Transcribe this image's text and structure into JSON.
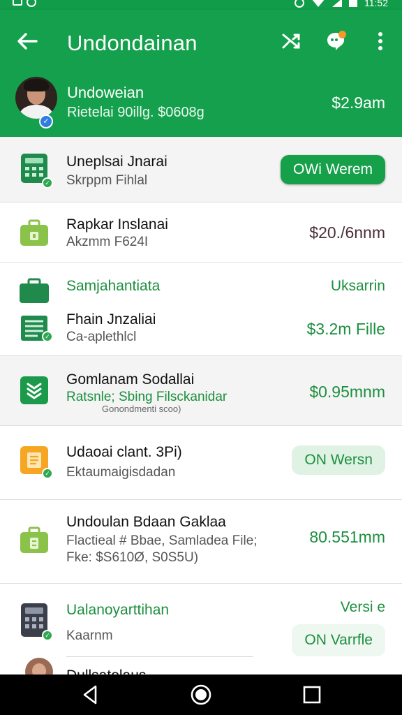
{
  "status_bar": {
    "time": "11:52"
  },
  "app_bar": {
    "title": "Undondainan"
  },
  "account": {
    "name": "Undoweian",
    "subtitle": "Rietelai 90illg. $0608g",
    "amount": "$2.9am"
  },
  "rows": [
    {
      "title": "Uneplsai Jnarai",
      "subtitle": "Skrppm Fihlal",
      "action": "OWi Werem",
      "icon": "calculator-icon",
      "color": "#1f8a4c"
    },
    {
      "title": "Rapkar Inslanai",
      "subtitle": "Akzmm F624I",
      "value": "$20./6nnm",
      "icon": "briefcase-icon",
      "color": "#8bc34a"
    },
    {
      "section": "Samjahantiata",
      "section_value": "Uksarrin",
      "title": "Fhain Jnzaliai",
      "subtitle": "Ca-aplethlcl",
      "value": "$3.2m Fille",
      "icon_top": "briefcase-icon",
      "icon": "receipt-icon",
      "color": "#1f8a4c"
    },
    {
      "title": "Gomlanam Sodallai",
      "subtitle": "Ratsnle; Sbing Filsckanidar",
      "faint": "Gonondmenti scoo)",
      "value": "$0.95mnm",
      "icon": "layers-icon",
      "color": "#1a9a4a"
    },
    {
      "title": "Udaoai clant. 3Pi)",
      "subtitle": "Ektaumaigisdadan",
      "action": "ON Wersn",
      "icon": "document-icon",
      "color": "#f6a623"
    },
    {
      "title": "Undoulan Bdaan Gaklaa",
      "subtitle": "Flactieal # Bbae, Samladea File;",
      "subtitle2": "Fke: $S610Ø, S0S5U)",
      "value": "80.551mm",
      "icon": "briefcase-icon",
      "color": "#8bc34a"
    },
    {
      "title": "Ualanoyarttihan",
      "subtitle": "Kaarnm",
      "value": "Versi e",
      "action": "ON Varrfle",
      "icon": "calculator-icon",
      "color": "#3a3f4b"
    }
  ],
  "partial_row": {
    "title": "Dullsatolaus"
  }
}
